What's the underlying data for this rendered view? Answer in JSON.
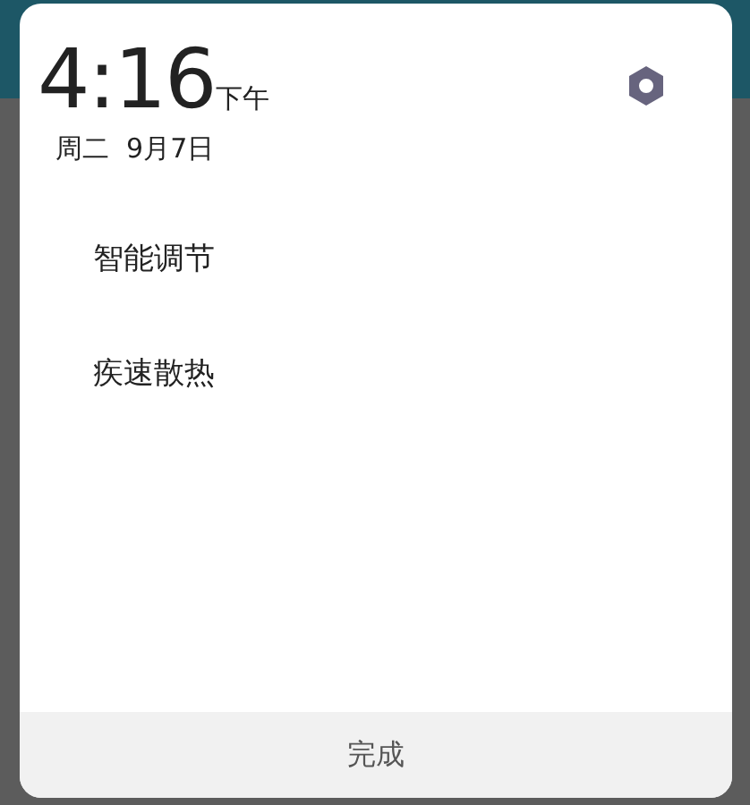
{
  "clock": {
    "time": "4:16",
    "period": "下午",
    "date": "周二  9月7日"
  },
  "options": [
    {
      "label": "智能调节"
    },
    {
      "label": "疾速散热"
    }
  ],
  "done_button": {
    "label": "完成"
  }
}
